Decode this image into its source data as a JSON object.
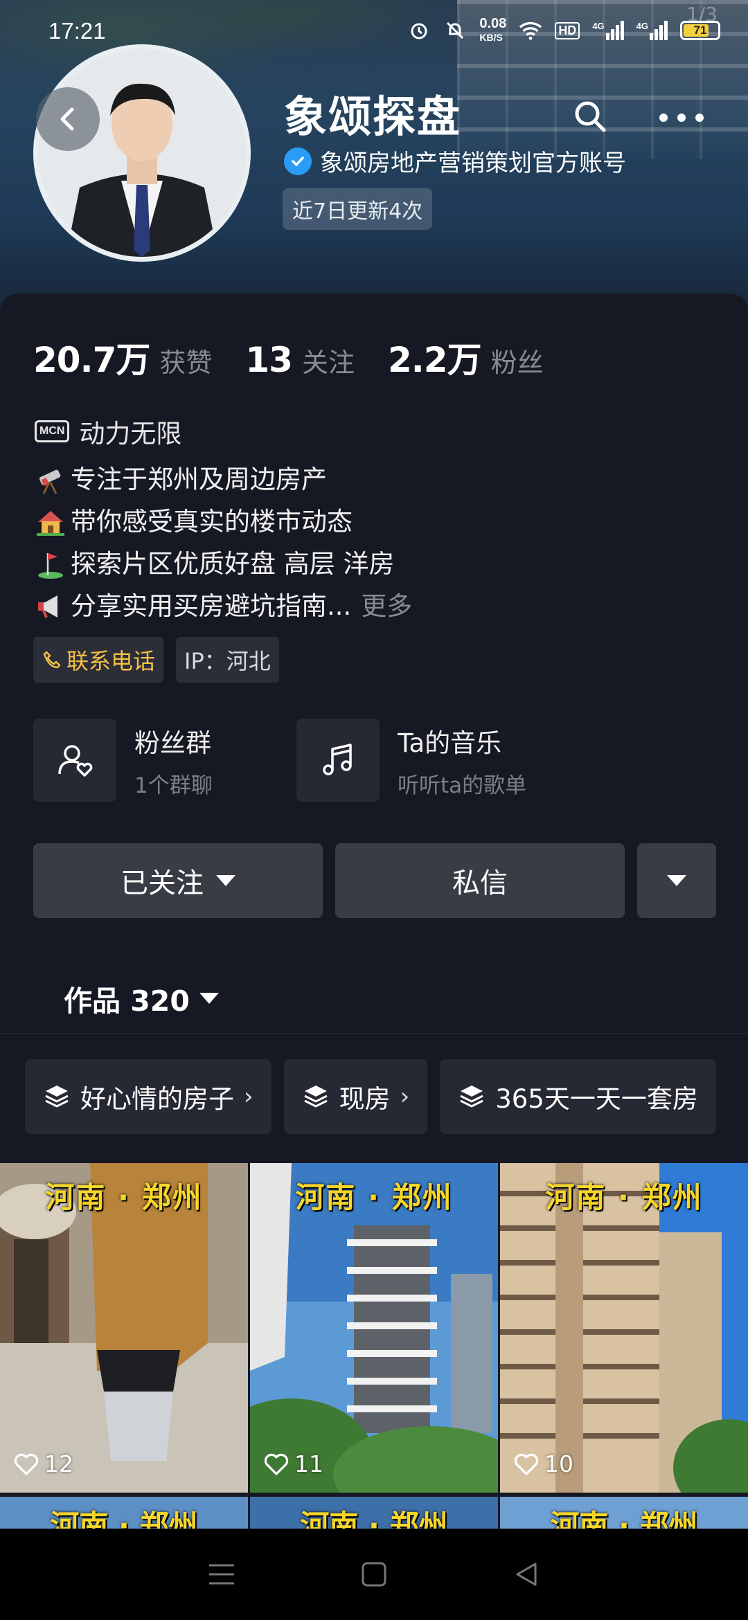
{
  "status_bar": {
    "time": "17:21",
    "net_speed_value": "0.08",
    "net_speed_unit": "KB/S",
    "hd_label": "HD",
    "sim1_label": "4G",
    "sim2_label": "4G",
    "battery": "71",
    "page_indicator": "1/3"
  },
  "header": {
    "name": "象颂探盘",
    "verified_text": "象颂房地产营销策划官方账号",
    "update_tag": "近7日更新4次",
    "icons": [
      "back-icon",
      "search-icon",
      "more-icon"
    ]
  },
  "stats": [
    {
      "num": "20.7万",
      "label": "获赞"
    },
    {
      "num": "13",
      "label": "关注"
    },
    {
      "num": "2.2万",
      "label": "粉丝"
    }
  ],
  "mcn": {
    "tag": "MCN",
    "text": "动力无限"
  },
  "bio": {
    "lines": [
      "专注于郑州及周边房产",
      "带你感受真实的楼市动态",
      "探索片区优质好盘 高层 洋房",
      "分享实用买房避坑指南..."
    ],
    "more": "更多"
  },
  "chips": {
    "phone": "联系电话",
    "ip": "IP：河北"
  },
  "services": [
    {
      "title": "粉丝群",
      "sub": "1个群聊"
    },
    {
      "title": "Ta的音乐",
      "sub": "听听ta的歌单"
    }
  ],
  "actions": {
    "follow": "已关注",
    "message": "私信"
  },
  "works_tab": "作品 320",
  "collections": [
    "好心情的房子",
    "现房",
    "365天一天一套房"
  ],
  "videos": [
    {
      "location": "河南 · 郑州",
      "likes": "12"
    },
    {
      "location": "河南 · 郑州",
      "likes": "11"
    },
    {
      "location": "河南 · 郑州",
      "likes": "10"
    }
  ],
  "videos_row2": [
    "河南 · 郑州",
    "河南 · 郑州",
    "河南 · 郑州"
  ],
  "colors": {
    "accent": "#f3c146",
    "verify": "#2b9cf5",
    "background": "#161823"
  }
}
